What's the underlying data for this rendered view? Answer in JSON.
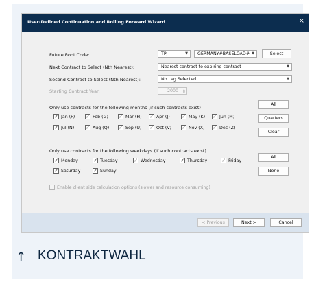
{
  "dialog": {
    "title": "User-Defined Continuation and Rolling Forward Wizard",
    "close_icon": "×"
  },
  "form": {
    "future_root_label": "Future Root Code:",
    "root_code_value": "TPJ",
    "root_name_value": "GERMANY#BASELOAD#",
    "select_button": "Select",
    "next_contract_label": "Next Contract to Select (Nth Nearest):",
    "next_contract_value": "Nearest contract to expiring contract",
    "second_contract_label": "Second Contract to Select (Nth Nearest):",
    "second_contract_value": "No Leg Selected",
    "starting_year_label": "Starting Contract Year:",
    "starting_year_value": "2000"
  },
  "months": {
    "label": "Only use contracts for the following months (if such contracts exist)",
    "items": [
      "Jan (F)",
      "Feb (G)",
      "Mar (H)",
      "Apr (J)",
      "May (K)",
      "Jun (M)",
      "Jul (N)",
      "Aug (Q)",
      "Sep (U)",
      "Oct (V)",
      "Nov (X)",
      "Dec (Z)"
    ],
    "all_button": "All",
    "quarters_button": "Quarters",
    "clear_button": "Clear"
  },
  "weekdays": {
    "label": "Only use contracts for the following weekdays (if such contracts exist)",
    "items": [
      "Monday",
      "Tuesday",
      "Wednesday",
      "Thursday",
      "Friday",
      "Saturday",
      "Sunday"
    ],
    "all_button": "All",
    "none_button": "None"
  },
  "client_side_label": "Enable client side calculation options (slower and resource consuming)",
  "footer": {
    "previous_button": "< Previous",
    "next_button": "Next >",
    "cancel_button": "Cancel"
  },
  "caption": {
    "arrow": "↑",
    "text": "KONTRAKTWAHL"
  },
  "colors": {
    "titlebar": "#0c2d4f",
    "panel": "#eef3f9",
    "footer": "#d9e3ee"
  }
}
